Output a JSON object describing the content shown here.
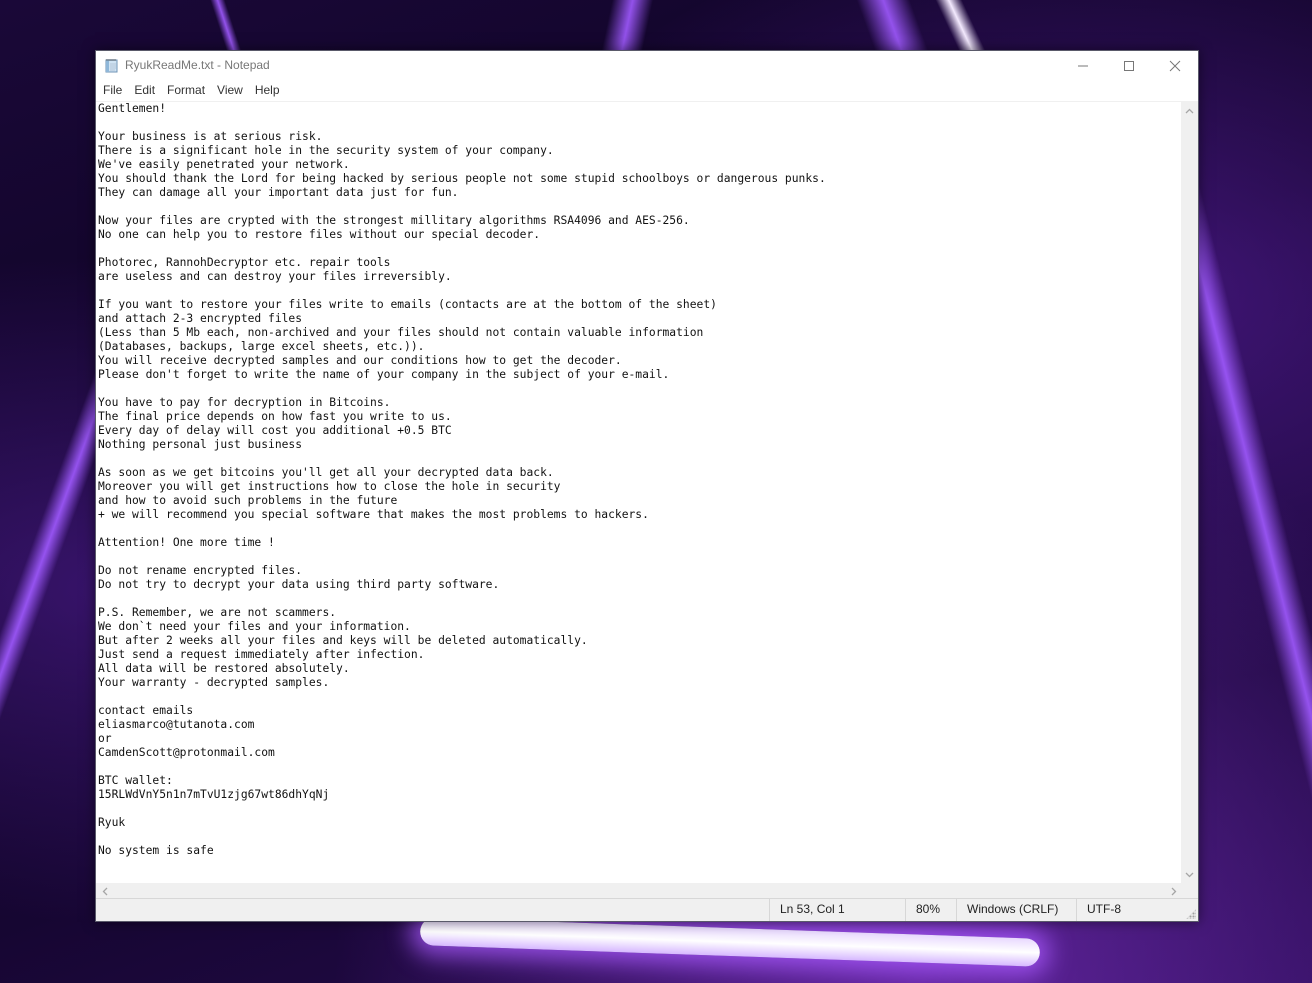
{
  "window": {
    "title": "RyukReadMe.txt - Notepad",
    "icon": "notepad-icon",
    "controls": {
      "minimize": "minimize-icon",
      "maximize": "maximize-icon",
      "close": "close-icon"
    }
  },
  "menu": {
    "items": [
      {
        "label": "File"
      },
      {
        "label": "Edit"
      },
      {
        "label": "Format"
      },
      {
        "label": "View"
      },
      {
        "label": "Help"
      }
    ]
  },
  "editor": {
    "lines": [
      "Gentlemen!",
      "",
      "Your business is at serious risk.",
      "There is a significant hole in the security system of your company.",
      "We've easily penetrated your network.",
      "You should thank the Lord for being hacked by serious people not some stupid schoolboys or dangerous punks.",
      "They can damage all your important data just for fun.",
      "",
      "Now your files are crypted with the strongest millitary algorithms RSA4096 and AES-256.",
      "No one can help you to restore files without our special decoder.",
      "",
      "Photorec, RannohDecryptor etc. repair tools",
      "are useless and can destroy your files irreversibly.",
      "",
      "If you want to restore your files write to emails (contacts are at the bottom of the sheet)",
      "and attach 2-3 encrypted files",
      "(Less than 5 Mb each, non-archived and your files should not contain valuable information",
      "(Databases, backups, large excel sheets, etc.)).",
      "You will receive decrypted samples and our conditions how to get the decoder.",
      "Please don't forget to write the name of your company in the subject of your e-mail.",
      "",
      "You have to pay for decryption in Bitcoins.",
      "The final price depends on how fast you write to us.",
      "Every day of delay will cost you additional +0.5 BTC",
      "Nothing personal just business",
      "",
      "As soon as we get bitcoins you'll get all your decrypted data back.",
      "Moreover you will get instructions how to close the hole in security",
      "and how to avoid such problems in the future",
      "+ we will recommend you special software that makes the most problems to hackers.",
      "",
      "Attention! One more time !",
      "",
      "Do not rename encrypted files.",
      "Do not try to decrypt your data using third party software.",
      "",
      "P.S. Remember, we are not scammers.",
      "We don`t need your files and your information.",
      "But after 2 weeks all your files and keys will be deleted automatically.",
      "Just send a request immediately after infection.",
      "All data will be restored absolutely.",
      "Your warranty - decrypted samples.",
      "",
      "contact emails",
      "eliasmarco@tutanota.com",
      "or",
      "CamdenScott@protonmail.com",
      "",
      "BTC wallet:",
      "15RLWdVnY5n1n7mTvU1zjg67wt86dhYqNj",
      "",
      "Ryuk",
      "",
      "No system is safe"
    ]
  },
  "statusbar": {
    "position": "Ln 53, Col 1",
    "zoom": "80%",
    "line_ending": "Windows (CRLF)",
    "encoding": "UTF-8"
  }
}
